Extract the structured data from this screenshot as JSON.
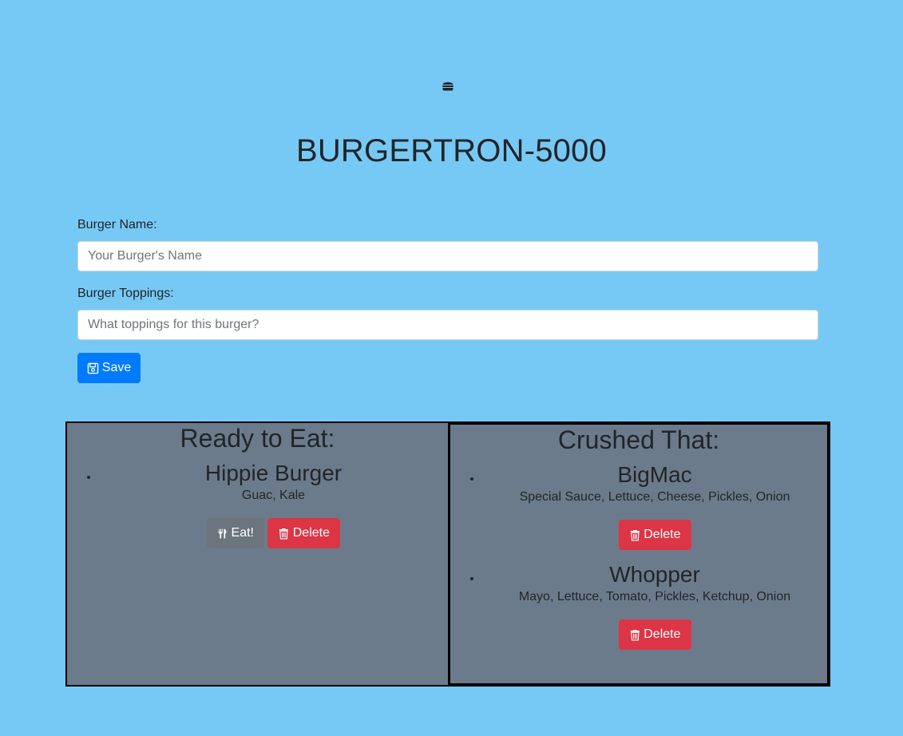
{
  "header": {
    "logo_icon": "hamburger-icon",
    "title": "BURGERTRON-5000"
  },
  "form": {
    "name_label": "Burger Name:",
    "name_placeholder": "Your Burger's Name",
    "name_value": "",
    "toppings_label": "Burger Toppings:",
    "toppings_placeholder": "What toppings for this burger?",
    "toppings_value": "",
    "save_label": "Save",
    "save_icon": "save-icon"
  },
  "ready": {
    "title": "Ready to Eat:",
    "items": [
      {
        "name": "Hippie Burger",
        "toppings": "Guac, Kale",
        "eat_label": "Eat!",
        "delete_label": "Delete"
      }
    ]
  },
  "crushed": {
    "title": "Crushed That:",
    "items": [
      {
        "name": "BigMac",
        "toppings": "Special Sauce, Lettuce, Cheese, Pickles, Onion",
        "delete_label": "Delete"
      },
      {
        "name": "Whopper",
        "toppings": "Mayo, Lettuce, Tomato, Pickles, Ketchup, Onion",
        "delete_label": "Delete"
      }
    ]
  },
  "colors": {
    "background": "#77c9f5",
    "panel": "#6c7b8b",
    "primary": "#007bff",
    "secondary": "#6c757d",
    "danger": "#dc3545"
  }
}
